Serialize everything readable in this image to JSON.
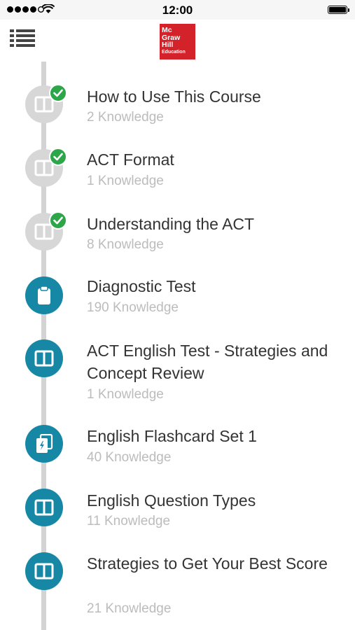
{
  "status_bar": {
    "time": "12:00"
  },
  "header": {
    "menu_icon": "list-menu-icon",
    "logo": {
      "line1": "Mc",
      "line2": "Graw",
      "line3": "Hill",
      "line4": "Education",
      "color": "#d3222a"
    }
  },
  "colors": {
    "active": "#1787a6",
    "completed": "#d7d7d7",
    "check": "#2da549",
    "timeline": "#d3d3d3"
  },
  "modules": [
    {
      "title": "How to Use This Course",
      "subtitle": "2 Knowledge",
      "status": "completed",
      "icon": "book-icon"
    },
    {
      "title": "ACT Format",
      "subtitle": "1 Knowledge",
      "status": "completed",
      "icon": "book-icon"
    },
    {
      "title": "Understanding the ACT",
      "subtitle": "8 Knowledge",
      "status": "completed",
      "icon": "book-icon"
    },
    {
      "title": "Diagnostic Test",
      "subtitle": "190 Knowledge",
      "status": "active",
      "icon": "clipboard-icon"
    },
    {
      "title": "ACT English Test - Strategies and Concept Review",
      "subtitle": "1 Knowledge",
      "status": "active",
      "icon": "book-icon"
    },
    {
      "title": "English Flashcard Set 1",
      "subtitle": "40 Knowledge",
      "status": "active",
      "icon": "flashcard-icon"
    },
    {
      "title": "English Question Types",
      "subtitle": "11 Knowledge",
      "status": "active",
      "icon": "book-icon"
    },
    {
      "title": "Strategies to Get Your Best Score",
      "subtitle": "21 Knowledge",
      "status": "active",
      "icon": "book-icon"
    }
  ]
}
